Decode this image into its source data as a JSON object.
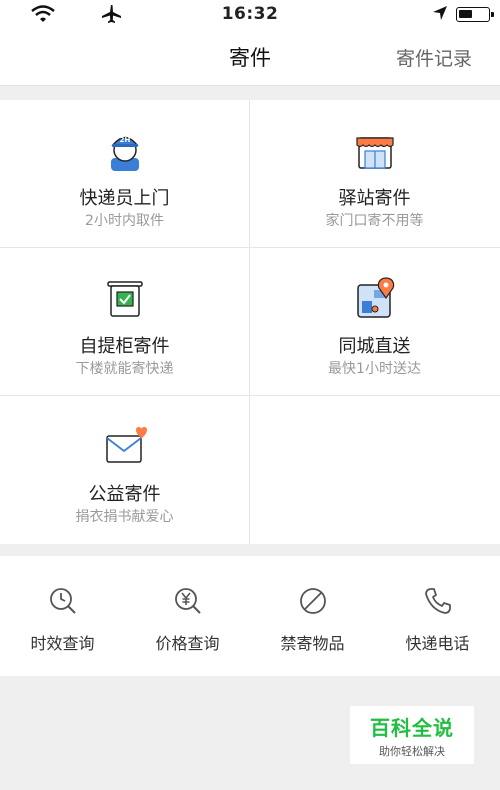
{
  "status_bar": {
    "time": "16:32"
  },
  "nav": {
    "title": "寄件",
    "record_label": "寄件记录"
  },
  "services": [
    {
      "label": "快递员上门",
      "sub": "2小时内取件",
      "icon": "courier-icon"
    },
    {
      "label": "驿站寄件",
      "sub": "家门口寄不用等",
      "icon": "station-icon"
    },
    {
      "label": "自提柜寄件",
      "sub": "下楼就能寄快递",
      "icon": "locker-icon"
    },
    {
      "label": "同城直送",
      "sub": "最快1小时送达",
      "icon": "map-pin-icon"
    },
    {
      "label": "公益寄件",
      "sub": "捐衣捐书献爱心",
      "icon": "charity-mail-icon"
    }
  ],
  "tools": [
    {
      "label": "时效查询",
      "icon": "clock-search-icon"
    },
    {
      "label": "价格查询",
      "icon": "yen-search-icon"
    },
    {
      "label": "禁寄物品",
      "icon": "prohibited-icon"
    },
    {
      "label": "快递电话",
      "icon": "phone-icon"
    }
  ],
  "watermark": {
    "title": "百科全说",
    "subtitle": "助你轻松解决"
  },
  "colors": {
    "accent_orange": "#ff7a45",
    "icon_blue": "#3a7fd5",
    "watermark_green": "#1fbf3f"
  }
}
